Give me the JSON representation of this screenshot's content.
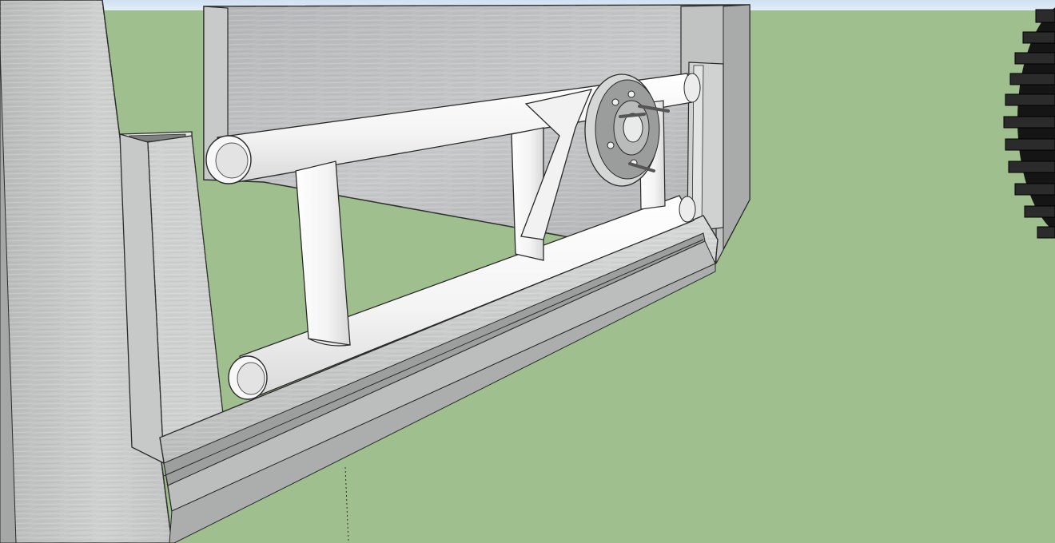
{
  "viewport": {
    "type": "3d-model-view",
    "sky_color": "#dbe9f5",
    "ground_color": "#9fc08e"
  },
  "materials": {
    "aluminum_light": "#d4d6d6",
    "aluminum_mid": "#b8baba",
    "aluminum_dark": "#9a9c9c",
    "tube_white": "#f4f4f4",
    "tube_shadow": "#d6d6d6",
    "hub_gray": "#8f9191",
    "tire_black": "#1a1a1a",
    "edge": "#222222"
  },
  "objects": [
    "aluminum-back-panel",
    "aluminum-left-post",
    "aluminum-square-tube",
    "aluminum-base-channel",
    "white-tube-frame",
    "wheel-hub-flange",
    "tire"
  ]
}
